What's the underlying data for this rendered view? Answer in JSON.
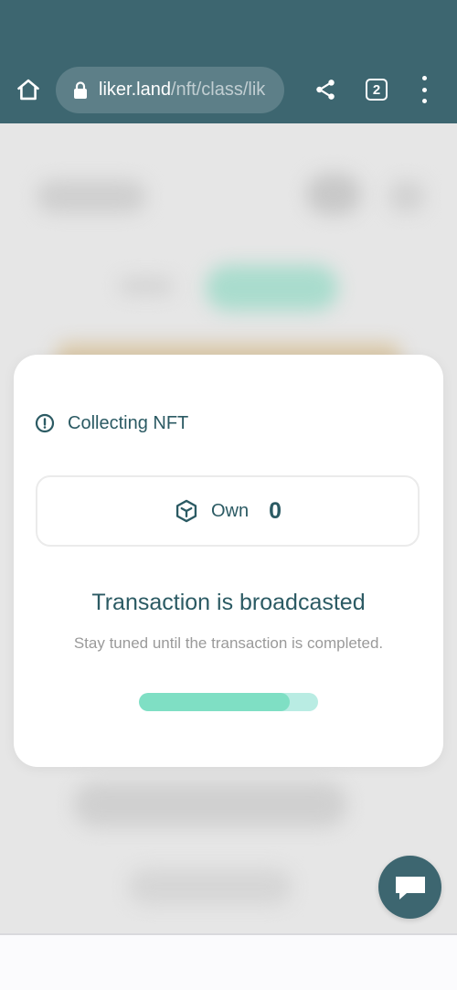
{
  "browser": {
    "url_host": "liker.land",
    "url_path": "/nft/class/lik",
    "tab_count": "2",
    "icons": {
      "home": "home-icon",
      "lock": "lock-icon",
      "share": "share-icon",
      "menu": "more-vert-icon"
    }
  },
  "modal": {
    "title": "Collecting NFT",
    "own_label": "Own",
    "own_count": "0",
    "status_title": "Transaction is broadcasted",
    "status_subtitle": "Stay tuned until the transaction is completed.",
    "progress_fraction": 0.84
  },
  "colors": {
    "brand": "#3d6670",
    "text_primary": "#2b5a63",
    "progress_fill": "#7fdfc4",
    "progress_track": "#b9ece3"
  },
  "chat": {
    "icon": "chat-bubble-icon"
  }
}
